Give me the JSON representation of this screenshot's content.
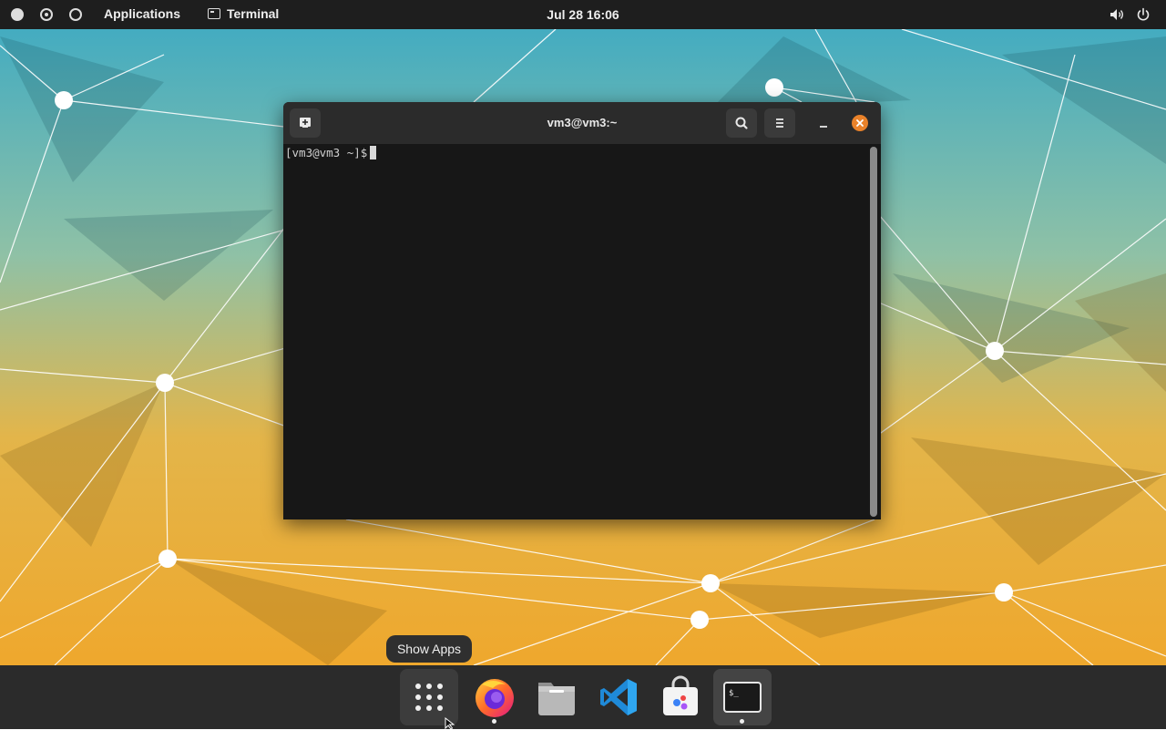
{
  "topbar": {
    "applications_label": "Applications",
    "active_app_label": "Terminal",
    "clock": "Jul 28  16:06",
    "volume_icon": "volume-icon",
    "power_icon": "power-icon"
  },
  "terminal": {
    "title": "vm3@vm3:~",
    "prompt": "[vm3@vm3 ~]$",
    "close_color": "#e9822a",
    "icons": [
      "new-tab-icon",
      "search-icon",
      "hamburger-menu-icon",
      "minimize-icon",
      "close-icon"
    ]
  },
  "tooltip": {
    "text": "Show Apps"
  },
  "dock": {
    "items": [
      {
        "name": "show-apps",
        "icon": "grid-icon",
        "running": false
      },
      {
        "name": "firefox",
        "icon": "firefox-icon",
        "running": true
      },
      {
        "name": "files",
        "icon": "folder-icon",
        "running": false
      },
      {
        "name": "vscode",
        "icon": "vscode-icon",
        "running": false
      },
      {
        "name": "software-store",
        "icon": "store-bag-icon",
        "running": false
      },
      {
        "name": "terminal",
        "icon": "terminal-icon",
        "running": true
      }
    ]
  }
}
